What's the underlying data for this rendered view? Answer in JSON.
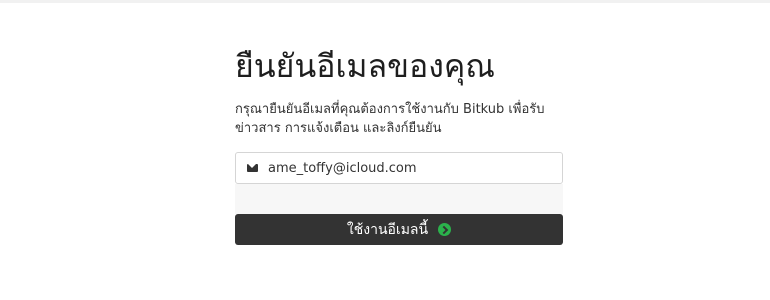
{
  "page": {
    "title": "ยืนยันอีเมลของคุณ",
    "description": "กรุณายืนยันอีเมลที่คุณต้องการใช้งานกับ Bitkub เพื่อรับข่าวสาร การแจ้งเตือน และลิงก์ยืนยัน"
  },
  "email_field": {
    "icon": "envelope-icon",
    "value": "ame_toffy@icloud.com"
  },
  "submit_button": {
    "label": "ใช้งานอีเมลนี้",
    "icon": "arrow-right-circle-icon",
    "icon_color": "#2bb24c",
    "background": "#333333"
  }
}
